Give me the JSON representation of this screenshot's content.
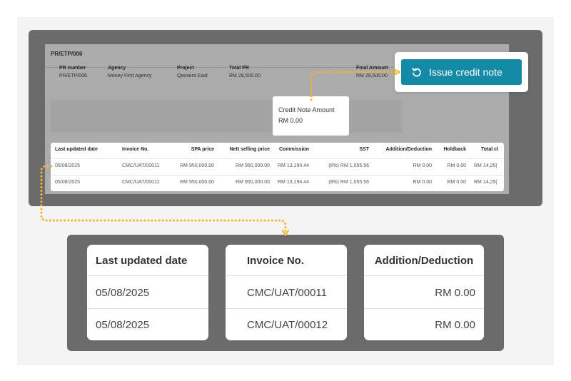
{
  "page": {
    "title": "PR/ETP/006"
  },
  "summary": [
    {
      "label": "PR number",
      "value": "PR/ETP/006"
    },
    {
      "label": "Agency",
      "value": "Money First Agency"
    },
    {
      "label": "Project",
      "value": "Qausera East"
    },
    {
      "label": "Total PR",
      "value": "RM 28,500.00"
    },
    {
      "label": "Final Amount",
      "value": "RM 28,500.00"
    }
  ],
  "credit_note": {
    "label": "Credit Note Amount",
    "value": "RM 0.00"
  },
  "action": {
    "label": "Issue credit note",
    "icon": "undo-icon"
  },
  "table": {
    "headers": [
      "Last updated date",
      "Invoice No.",
      "SPA price",
      "Nett selling price",
      "Commission",
      "SST",
      "Addition/Deduction",
      "Holdback",
      "Total cl"
    ],
    "rows": [
      [
        "05/08/2025",
        "CMC/UAT/00011",
        "RM 950,000.00",
        "RM 950,000.00",
        "RM 13,194.44",
        "(8%) RM 1,055.56",
        "RM 0.00",
        "RM 0.00",
        "RM 14,25("
      ],
      [
        "05/08/2025",
        "CMC/UAT/00012",
        "RM 950,000.00",
        "RM 950,000.00",
        "RM 13,194.44",
        "(8%) RM 1,055.56",
        "RM 0.00",
        "RM 0.00",
        "RM 14,25("
      ]
    ]
  },
  "zoom": [
    {
      "header": "Last updated date",
      "values": [
        "05/08/2025",
        "05/08/2025"
      ]
    },
    {
      "header": "Invoice No.",
      "values": [
        "CMC/UAT/00011",
        "CMC/UAT/00012"
      ]
    },
    {
      "header": "Addition/Deduction",
      "values": [
        "RM 0.00",
        "RM 0.00"
      ]
    }
  ],
  "colors": {
    "accent": "#148aa6",
    "connector": "#f2b530",
    "frame": "#6b6b6b"
  }
}
